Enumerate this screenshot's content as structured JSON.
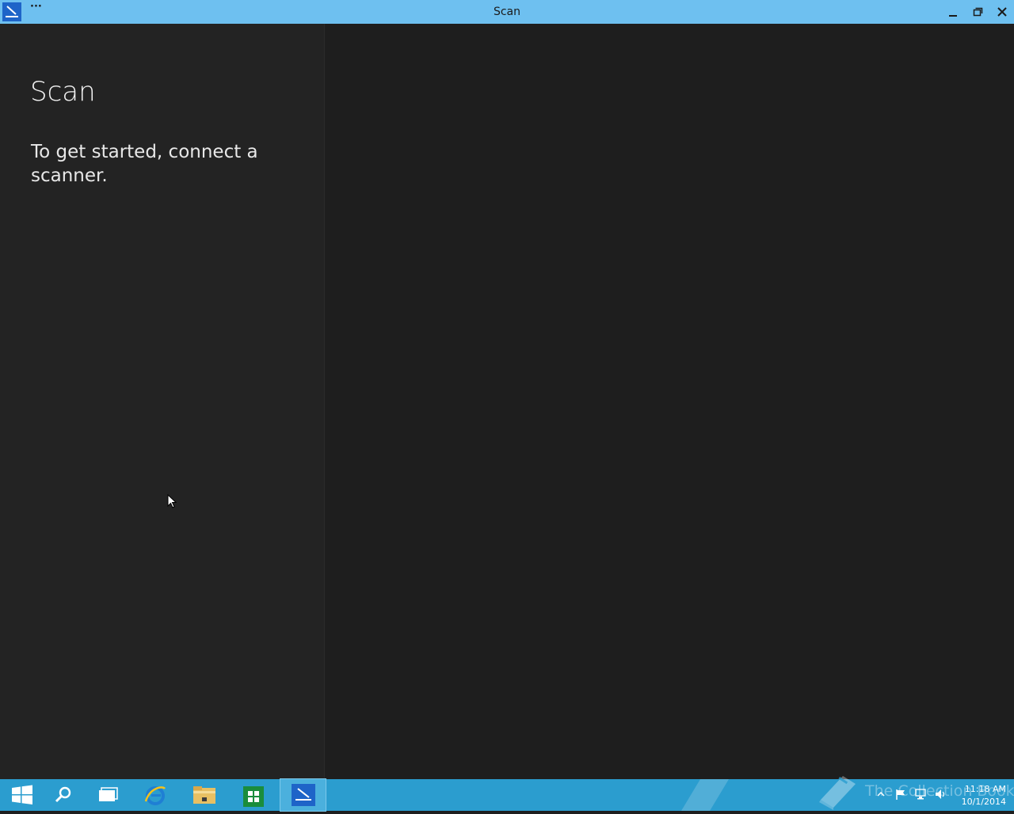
{
  "window": {
    "title": "Scan",
    "more_label": "···",
    "app_icon": "scanner-app-icon",
    "controls": [
      "minimize-icon",
      "maximize-icon",
      "close-icon"
    ]
  },
  "left_pane": {
    "heading": "Scan",
    "message": "To get started, connect a scanner."
  },
  "taskbar": {
    "items": [
      {
        "name": "start",
        "icon": "windows-logo-icon"
      },
      {
        "name": "search",
        "icon": "search-icon"
      },
      {
        "name": "task-view",
        "icon": "task-view-icon"
      },
      {
        "name": "internet-explorer",
        "icon": "ie-icon"
      },
      {
        "name": "file-explorer",
        "icon": "folder-icon"
      },
      {
        "name": "store",
        "icon": "store-icon"
      },
      {
        "name": "scan",
        "icon": "scanner-app-icon",
        "active": true
      }
    ],
    "watermark_text": "The Collection Book",
    "tray_icons": [
      "show-hidden-icon",
      "flag-icon",
      "network-icon",
      "volume-icon"
    ],
    "time": "11:18 AM",
    "date": "10/1/2014"
  },
  "colors": {
    "titlebar": "#6ec0f0",
    "taskbar": "#2b9dcf",
    "left_pane": "#232323",
    "right_pane": "#1e1e1e"
  }
}
